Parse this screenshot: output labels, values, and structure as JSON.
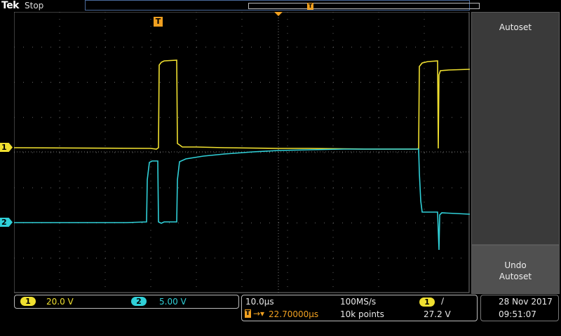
{
  "header": {
    "brand": "Tek",
    "acq_status": "Stop",
    "trigger_marker": "T"
  },
  "screen": {
    "trigger_label": "T",
    "ch1_marker": "1",
    "ch2_marker": "2"
  },
  "menu": {
    "autoset_label": "Autoset",
    "undo_label_line1": "Undo",
    "undo_label_line2": "Autoset"
  },
  "channels": [
    {
      "id": "1",
      "scale": "20.0 V",
      "color": "#f0e030"
    },
    {
      "id": "2",
      "scale": "5.00 V",
      "color": "#30d0d8"
    }
  ],
  "timebase": {
    "scale": "10.0µs",
    "delay": "22.70000µs",
    "sample_rate": "100MS/s",
    "record_length": "10k points"
  },
  "trigger": {
    "source": "1",
    "slope": "∕",
    "level": "27.2 V"
  },
  "datetime": {
    "date": "28 Nov 2017",
    "time": "09:51:07"
  },
  "colors": {
    "ch1": "#f0e030",
    "ch2": "#30d0d8",
    "trigger": "#f0a020",
    "grid": "#555555"
  }
}
